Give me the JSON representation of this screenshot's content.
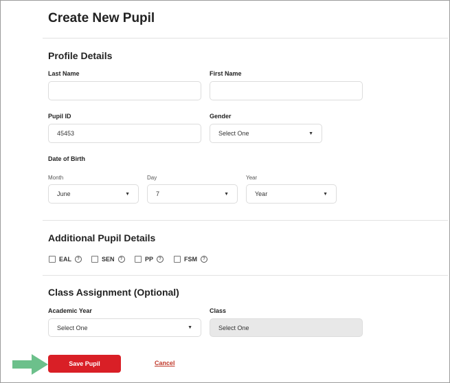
{
  "page": {
    "title": "Create New Pupil"
  },
  "profile": {
    "heading": "Profile Details",
    "last_name": {
      "label": "Last Name",
      "value": ""
    },
    "first_name": {
      "label": "First Name",
      "value": ""
    },
    "pupil_id": {
      "label": "Pupil ID",
      "value": "45453"
    },
    "gender": {
      "label": "Gender",
      "selected": "Select One"
    },
    "dob": {
      "label": "Date of Birth",
      "month": {
        "label": "Month",
        "selected": "June"
      },
      "day": {
        "label": "Day",
        "selected": "7"
      },
      "year": {
        "label": "Year",
        "selected": "Year"
      }
    }
  },
  "additional": {
    "heading": "Additional Pupil Details",
    "checkboxes": [
      {
        "label": "EAL",
        "checked": false
      },
      {
        "label": "SEN",
        "checked": false
      },
      {
        "label": "PP",
        "checked": false
      },
      {
        "label": "FSM",
        "checked": false
      }
    ],
    "help_glyph": "?"
  },
  "class_assignment": {
    "heading": "Class Assignment (Optional)",
    "academic_year": {
      "label": "Academic Year",
      "selected": "Select One"
    },
    "class": {
      "label": "Class",
      "selected": "Select One"
    }
  },
  "actions": {
    "save_label": "Save Pupil",
    "cancel_label": "Cancel"
  },
  "icons": {
    "caret": "▼",
    "arrow": "arrow-right"
  },
  "colors": {
    "primary": "#d91f26",
    "arrow": "#6cc08b",
    "cancel": "#c0392b"
  }
}
